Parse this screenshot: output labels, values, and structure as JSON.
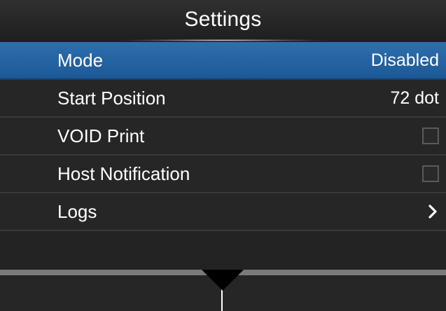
{
  "header": {
    "title": "Settings"
  },
  "rows": [
    {
      "label": "Mode",
      "value": "Disabled",
      "kind": "value",
      "selected": true
    },
    {
      "label": "Start Position",
      "value": "72 dot",
      "kind": "value",
      "selected": false
    },
    {
      "label": "VOID Print",
      "kind": "checkbox",
      "checked": false,
      "selected": false
    },
    {
      "label": "Host Notification",
      "kind": "checkbox",
      "checked": false,
      "selected": false
    },
    {
      "label": "Logs",
      "kind": "submenu",
      "icon": "chevron-right-icon",
      "selected": false
    }
  ],
  "colors": {
    "selected_row": "#2469a8",
    "row_background": "#262626",
    "footer_bar": "#7a7a7a"
  }
}
